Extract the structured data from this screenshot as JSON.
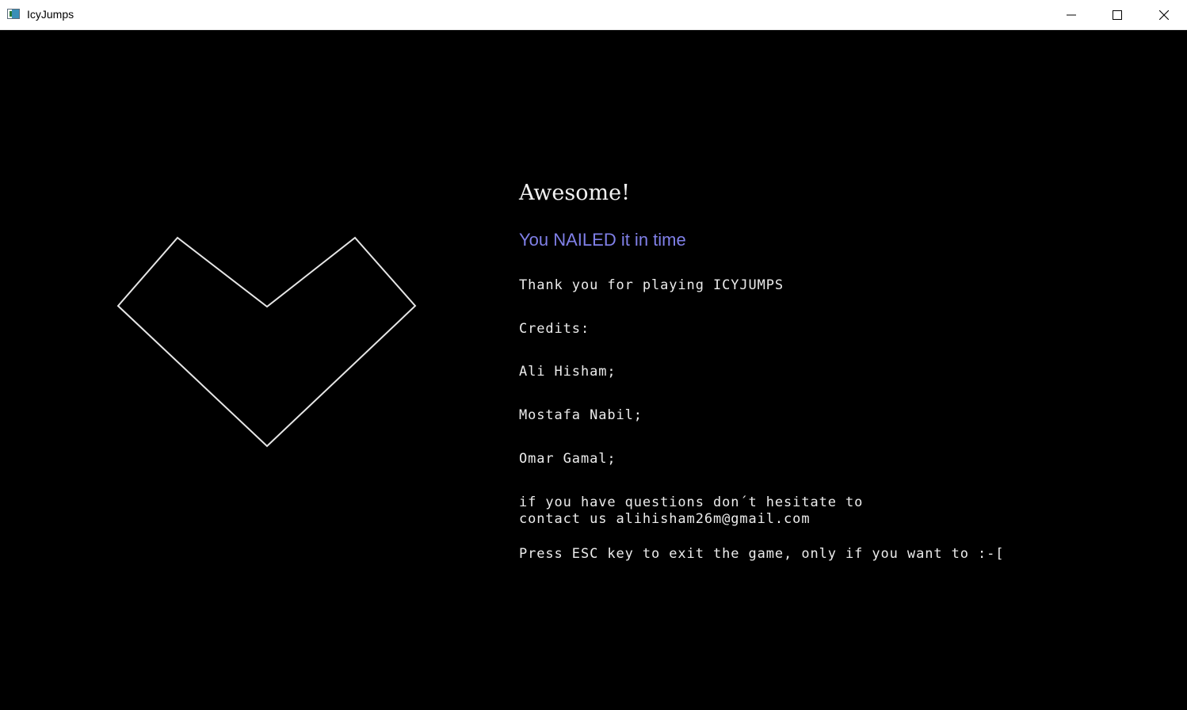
{
  "window": {
    "title": "IcyJumps",
    "icons": {
      "app": "app-window-icon",
      "minimize": "minimize-icon",
      "maximize": "maximize-icon",
      "close": "close-icon"
    }
  },
  "colors": {
    "background": "#000000",
    "text": "#ffffff",
    "accent": "#8080e8",
    "heart_outline": "#e6e6e6"
  },
  "shapes": {
    "heart": "heart-outline-icon"
  },
  "screen": {
    "headline": "Awesome!",
    "subheadline": "You NAILED it in time",
    "thanks": "Thank you for playing ICYJUMPS",
    "credits_label": "Credits:",
    "credits": [
      "Ali Hisham;",
      "Mostafa Nabil;",
      "Omar Gamal;"
    ],
    "contact_line1": "if you have questions don´t hesitate to",
    "contact_line2": "contact us alihisham26m@gmail.com",
    "exit_hint": "Press ESC key to exit the game, only if you want to :-["
  }
}
